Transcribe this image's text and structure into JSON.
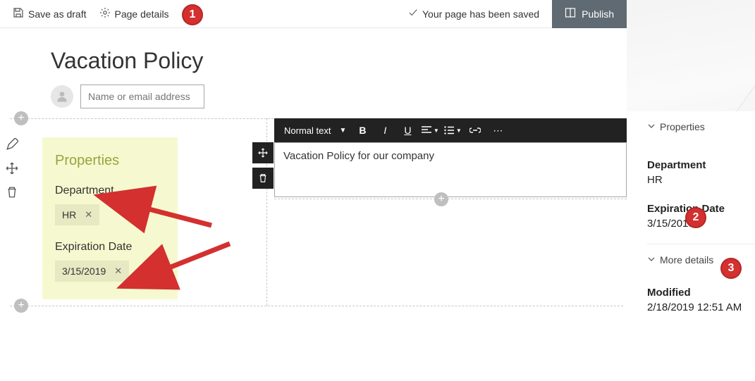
{
  "topbar": {
    "save_draft": "Save as draft",
    "page_details": "Page details",
    "saved_msg": "Your page has been saved",
    "publish": "Publish"
  },
  "page": {
    "title": "Vacation Policy",
    "author_placeholder": "Name or email address"
  },
  "props_panel": {
    "title": "Properties",
    "dept_label": "Department",
    "dept_value": "HR",
    "exp_label": "Expiration Date",
    "exp_value": "3/15/2019"
  },
  "editor": {
    "style_label": "Normal text",
    "body": "Vacation Policy for our company"
  },
  "sidebar": {
    "sec_props": "Properties",
    "dept_label": "Department",
    "dept_value": "HR",
    "exp_label": "Expiration Date",
    "exp_value": "3/15/2019",
    "sec_more": "More details",
    "mod_label": "Modified",
    "mod_value": "2/18/2019 12:51 AM"
  },
  "annotations": {
    "b1": "1",
    "b2": "2",
    "b3": "3"
  }
}
